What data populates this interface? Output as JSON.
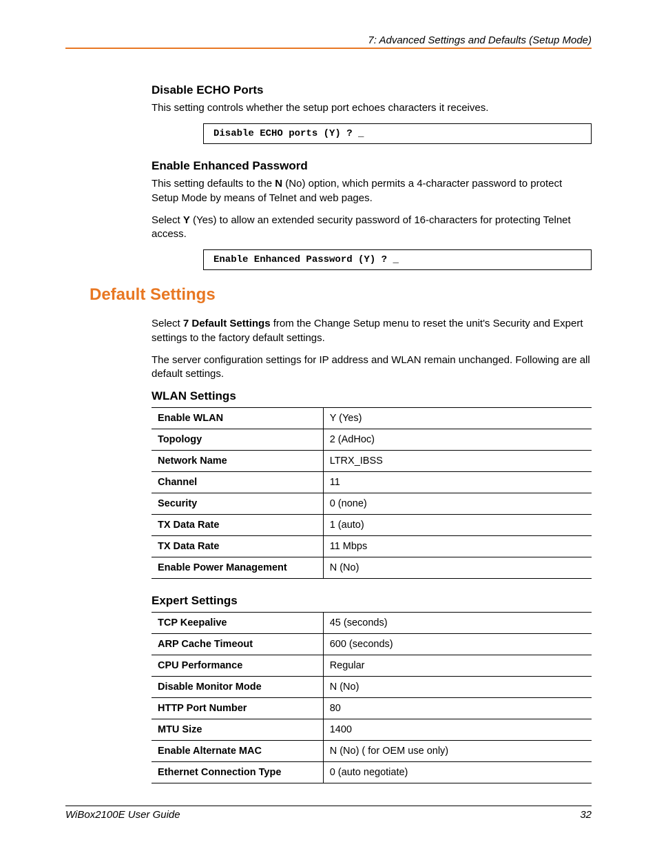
{
  "header": "7: Advanced Settings and Defaults (Setup Mode)",
  "sec1": {
    "title": "Disable ECHO Ports",
    "p1": "This setting controls whether the setup port echoes characters it receives.",
    "code": "Disable ECHO ports (Y) ? _"
  },
  "sec2": {
    "title": "Enable Enhanced Password",
    "p1a": "This setting defaults to the ",
    "p1b": "N",
    "p1c": " (No) option, which permits a 4-character password to protect Setup Mode by means of Telnet and web pages.",
    "p2a": "Select ",
    "p2b": "Y",
    "p2c": " (Yes) to allow an extended security password of 16-characters for protecting Telnet access.",
    "code": "Enable Enhanced Password (Y) ? _"
  },
  "sec3": {
    "title": "Default Settings",
    "p1a": "Select ",
    "p1b": "7 Default Settings",
    "p1c": " from the Change Setup menu to reset the unit's Security and Expert settings to the factory default settings.",
    "p2": "The server configuration settings for IP address and WLAN remain unchanged. Following are all default settings."
  },
  "wlan": {
    "title": "WLAN Settings",
    "rows": [
      {
        "k": "Enable WLAN",
        "v": "Y (Yes)"
      },
      {
        "k": "Topology",
        "v": "2 (AdHoc)"
      },
      {
        "k": "Network Name",
        "v": "LTRX_IBSS"
      },
      {
        "k": "Channel",
        "v": "11"
      },
      {
        "k": "Security",
        "v": "0 (none)"
      },
      {
        "k": "TX Data Rate",
        "v": "1 (auto)"
      },
      {
        "k": "TX Data Rate",
        "v": "11 Mbps"
      },
      {
        "k": "Enable Power Management",
        "v": "N (No)"
      }
    ]
  },
  "expert": {
    "title": "Expert Settings",
    "rows": [
      {
        "k": "TCP Keepalive",
        "v": "45 (seconds)"
      },
      {
        "k": "ARP Cache Timeout",
        "v": "600 (seconds)"
      },
      {
        "k": "CPU Performance",
        "v": "Regular"
      },
      {
        "k": "Disable Monitor Mode",
        "v": "N (No)"
      },
      {
        "k": "HTTP Port Number",
        "v": "80"
      },
      {
        "k": "MTU Size",
        "v": "1400"
      },
      {
        "k": "Enable Alternate MAC",
        "v": "N (No) ( for OEM use only)"
      },
      {
        "k": "Ethernet Connection Type",
        "v": "0 (auto negotiate)"
      }
    ]
  },
  "footer": {
    "title": "WiBox2100E User Guide",
    "page": "32"
  }
}
